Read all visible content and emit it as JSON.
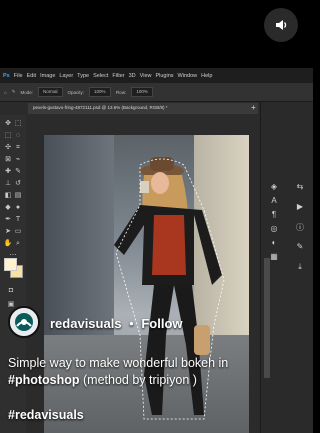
{
  "photoshop": {
    "menu": [
      "File",
      "Edit",
      "Image",
      "Layer",
      "Type",
      "Select",
      "Filter",
      "3D",
      "View",
      "Plugins",
      "Window",
      "Help"
    ],
    "options": {
      "mode_label": "Mode:",
      "mode_value": "Normal",
      "opacity_label": "Opacity:",
      "opacity_value": "100%",
      "flow_label": "Flow:",
      "flow_value": "100%"
    },
    "document_tab": "pexels-gustavo-fring-4872111.psd @ 13.6% (Background, RGB/8) *"
  },
  "post": {
    "username": "redavisuals",
    "separator": "•",
    "follow_label": "Follow",
    "caption_text": "Simple way to make wonderful bokeh in ",
    "caption_hashtag": "#photoshop",
    "caption_suffix": " (method by tripiyon )",
    "tag": "#redavisuals"
  },
  "colors": {
    "accent_bg": "#000000",
    "text": "#ffffff"
  },
  "icons": {
    "sound": "speaker-icon"
  }
}
